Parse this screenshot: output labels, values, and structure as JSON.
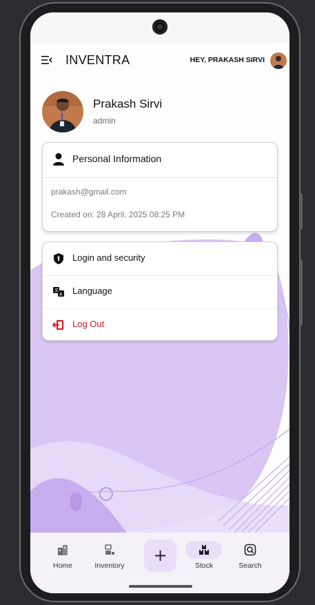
{
  "app": {
    "title": "INVENTRA",
    "greeting": "HEY, PRAKASH SIRVI"
  },
  "profile": {
    "name": "Prakash Sirvi",
    "role": "admin"
  },
  "personal_info": {
    "heading": "Personal Information",
    "email": "prakash@gmail.com",
    "created": "Created on: 28 April, 2025 08:25 PM"
  },
  "settings": {
    "items": [
      {
        "label": "Login and security",
        "icon": "shield-icon"
      },
      {
        "label": "Language",
        "icon": "translate-icon"
      },
      {
        "label": "Log Out",
        "icon": "logout-icon"
      }
    ]
  },
  "bottom_nav": {
    "items": [
      {
        "label": "Home",
        "icon": "home-icon"
      },
      {
        "label": "Inventory",
        "icon": "inventory-icon"
      },
      {
        "label": "Stock",
        "icon": "stock-icon",
        "active": true
      },
      {
        "label": "Search",
        "icon": "search-icon"
      }
    ],
    "fab_label": "+"
  },
  "colors": {
    "accent": "#e8def8",
    "logout": "#d3141e",
    "background_shape": "#d8c4f3"
  }
}
